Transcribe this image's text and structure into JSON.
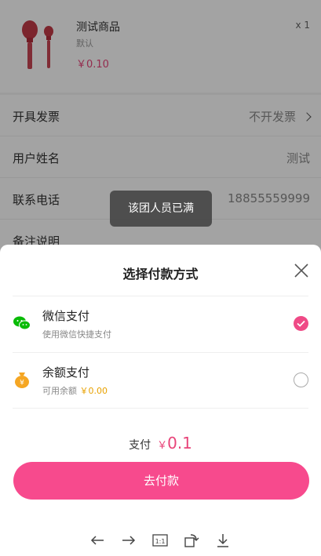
{
  "product": {
    "name": "测试商品",
    "spec": "默认",
    "price": "￥0.10",
    "qty": "x 1"
  },
  "form": {
    "invoice_label": "开具发票",
    "invoice_value": "不开发票",
    "name_label": "用户姓名",
    "name_value": "测试",
    "phone_label": "联系电话",
    "phone_value": "18855559999",
    "note_label": "备注说明"
  },
  "toast": "该团人员已满",
  "sheet": {
    "title": "选择付款方式",
    "options": [
      {
        "name": "微信支付",
        "sub": "使用微信快捷支付",
        "icon": "wechat-icon",
        "selected": true
      },
      {
        "name": "余额支付",
        "sub": "可用余额",
        "amount": "￥0.00",
        "icon": "balance-icon",
        "selected": false
      }
    ],
    "total_label": "支付",
    "currency": "￥",
    "total_value": "0.1",
    "pay_button": "去付款"
  },
  "nav_icons": [
    "arrow-left-icon",
    "arrow-right-icon",
    "actual-size-icon",
    "rotate-icon",
    "download-icon"
  ],
  "colors": {
    "accent": "#f74a8d",
    "wechat": "#09bb07",
    "balance": "#f5a623"
  }
}
